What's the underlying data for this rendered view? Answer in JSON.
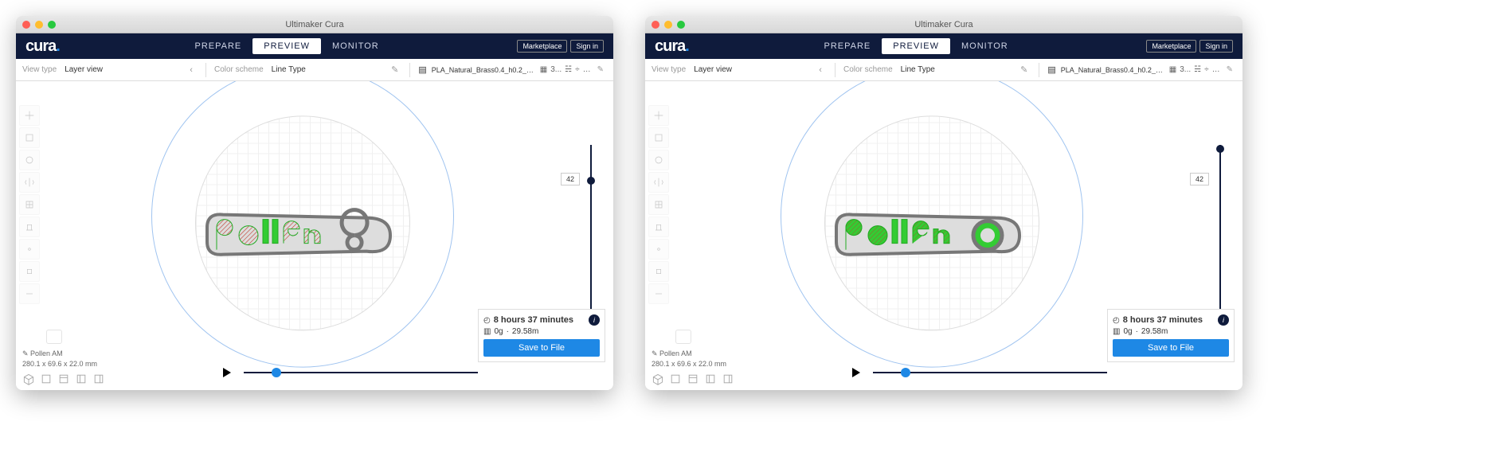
{
  "window_title": "Ultimaker Cura",
  "logo_text": "cura",
  "tabs": {
    "prepare": "PREPARE",
    "preview": "PREVIEW",
    "monitor": "MONITOR"
  },
  "marketplace": "Marketplace",
  "signin": "Sign in",
  "subbar": {
    "view_type_label": "View type",
    "view_type_value": "Layer view",
    "color_scheme_label": "Color scheme",
    "color_scheme_value": "Line Type",
    "material": "PLA_Natural_Brass0.4_h0.2_AC 0...",
    "extra": "3..."
  },
  "slider_layer": "42",
  "info": {
    "time": "8 hours 37 minutes",
    "mass": "0g",
    "length": "29.58m",
    "save": "Save to File"
  },
  "footer": {
    "name": "Pollen AM",
    "dims": "280.1 x 69.6 x 22.0 mm"
  },
  "model_text": "pollen"
}
